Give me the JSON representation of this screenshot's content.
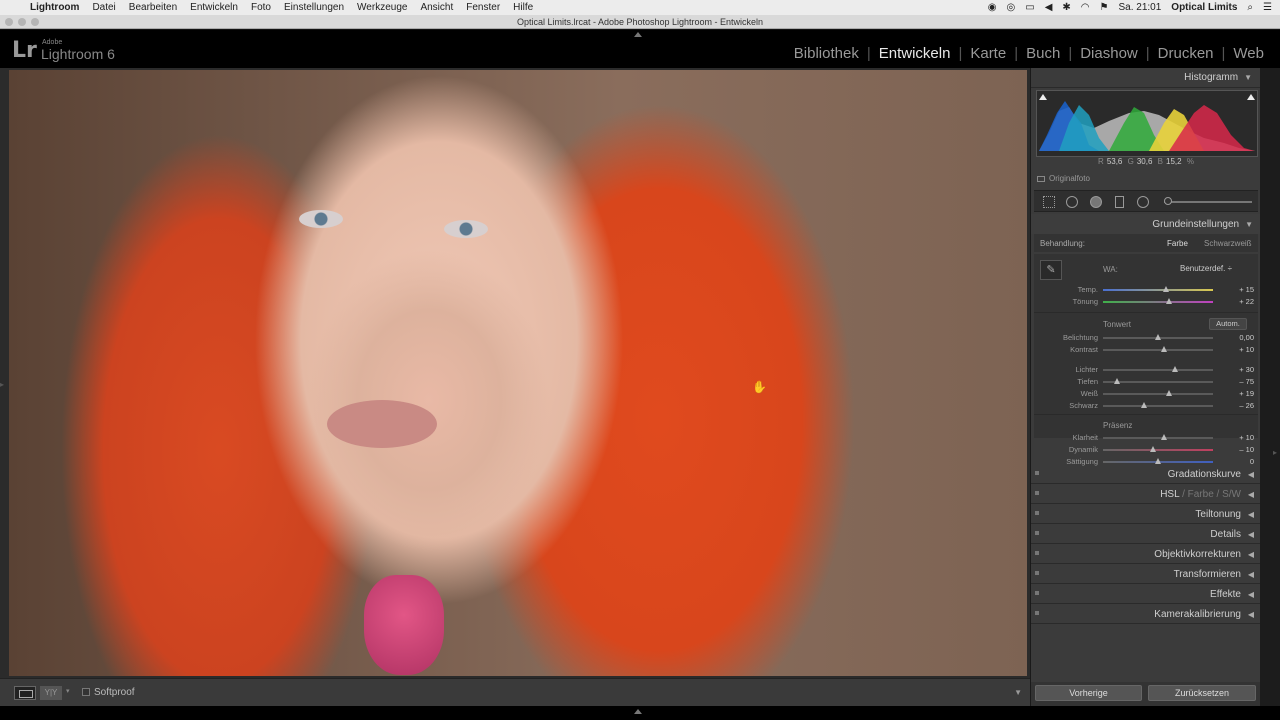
{
  "menubar": {
    "app_name": "Lightroom",
    "items": [
      "Datei",
      "Bearbeiten",
      "Entwickeln",
      "Foto",
      "Einstellungen",
      "Werkzeuge",
      "Ansicht",
      "Fenster",
      "Hilfe"
    ],
    "clock": "Sa. 21:01",
    "user": "Optical Limits"
  },
  "window": {
    "title": "Optical Limits.lrcat - Adobe Photoshop Lightroom - Entwickeln"
  },
  "brand": {
    "lr": "Lr",
    "adobe": "Adobe",
    "product": "Lightroom 6"
  },
  "modules": [
    {
      "label": "Bibliothek",
      "active": false
    },
    {
      "label": "Entwickeln",
      "active": true
    },
    {
      "label": "Karte",
      "active": false
    },
    {
      "label": "Buch",
      "active": false
    },
    {
      "label": "Diashow",
      "active": false
    },
    {
      "label": "Drucken",
      "active": false
    },
    {
      "label": "Web",
      "active": false
    }
  ],
  "toolbar": {
    "yy_label": "Y|Y",
    "softproof_label": "Softproof"
  },
  "histogram": {
    "title": "Histogramm",
    "r_label": "R",
    "r_value": "53,6",
    "g_label": "G",
    "g_value": "30,6",
    "b_label": "B",
    "b_value": "15,2",
    "unit": "%",
    "original_label": "Originalfoto"
  },
  "basic": {
    "title": "Grundeinstellungen",
    "treatment_label": "Behandlung:",
    "treatment_color": "Farbe",
    "treatment_bw": "Schwarzweiß",
    "wb_label": "WA:",
    "wb_value": "Benutzerdef. ÷",
    "tone_label": "Tonwert",
    "auto_label": "Autom.",
    "presence_label": "Präsenz",
    "wb_sliders": [
      {
        "name": "Temp.",
        "value": "+ 15",
        "pos": 0.57
      },
      {
        "name": "Tönung",
        "value": "+ 22",
        "pos": 0.6
      }
    ],
    "tone_sliders": [
      {
        "name": "Belichtung",
        "value": "0,00",
        "pos": 0.5
      },
      {
        "name": "Kontrast",
        "value": "+ 10",
        "pos": 0.55
      }
    ],
    "tone_sliders2": [
      {
        "name": "Lichter",
        "value": "+ 30",
        "pos": 0.65
      },
      {
        "name": "Tiefen",
        "value": "– 75",
        "pos": 0.13
      },
      {
        "name": "Weiß",
        "value": "+ 19",
        "pos": 0.6
      },
      {
        "name": "Schwarz",
        "value": "– 26",
        "pos": 0.37
      }
    ],
    "presence_sliders": [
      {
        "name": "Klarheit",
        "value": "+ 10",
        "pos": 0.55
      },
      {
        "name": "Dynamik",
        "value": "– 10",
        "pos": 0.45
      },
      {
        "name": "Sättigung",
        "value": "0",
        "pos": 0.5
      }
    ]
  },
  "collapsed_panels": [
    {
      "label": "Gradationskurve"
    },
    {
      "label": "HSL",
      "extra": [
        " / ",
        "Farbe",
        " / ",
        "S/W"
      ]
    },
    {
      "label": "Teiltonung"
    },
    {
      "label": "Details"
    },
    {
      "label": "Objektivkorrekturen"
    },
    {
      "label": "Transformieren"
    },
    {
      "label": "Effekte"
    },
    {
      "label": "Kamerakalibrierung"
    }
  ],
  "buttons": {
    "previous": "Vorherige",
    "reset": "Zurücksetzen"
  },
  "colors": {
    "panel": "#3b3b3b",
    "active_module": "#e8e8e8"
  }
}
